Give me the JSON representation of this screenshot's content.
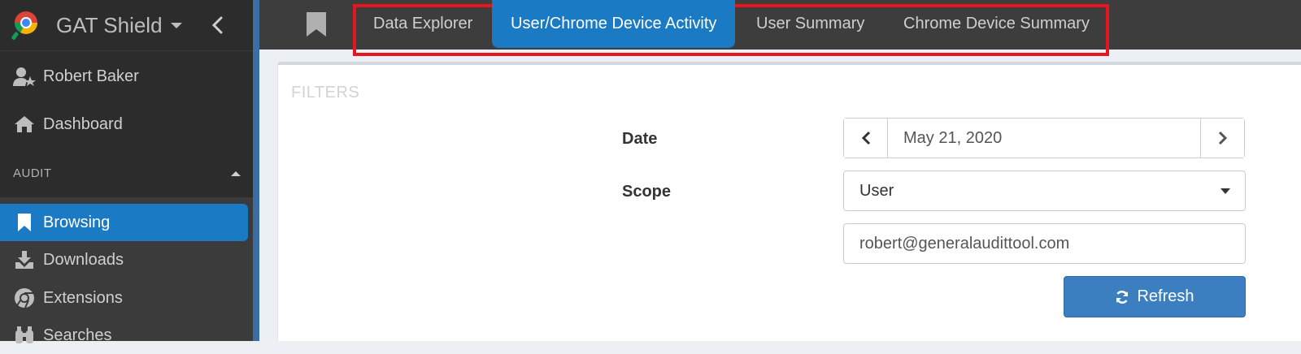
{
  "app": {
    "title": "GAT Shield"
  },
  "sidebar": {
    "user": "Robert Baker",
    "dashboard": "Dashboard",
    "section": "AUDIT",
    "items": [
      {
        "label": "Browsing",
        "icon": "bookmark-icon",
        "active": true
      },
      {
        "label": "Downloads",
        "icon": "download-icon"
      },
      {
        "label": "Extensions",
        "icon": "chrome-icon"
      },
      {
        "label": "Searches",
        "icon": "binoculars-icon"
      }
    ]
  },
  "tabs": [
    {
      "label": "Data Explorer"
    },
    {
      "label": "User/Chrome Device Activity",
      "active": true
    },
    {
      "label": "User Summary"
    },
    {
      "label": "Chrome Device Summary"
    }
  ],
  "filters": {
    "heading": "FILTERS",
    "date_label": "Date",
    "date_value": "May 21, 2020",
    "scope_label": "Scope",
    "scope_value": "User",
    "user_value": "robert@generalaudittool.com",
    "refresh_label": "Refresh"
  },
  "colors": {
    "accent": "#1a7ac4",
    "highlight": "#e8141e",
    "sidebar": "#2c2c2c"
  }
}
